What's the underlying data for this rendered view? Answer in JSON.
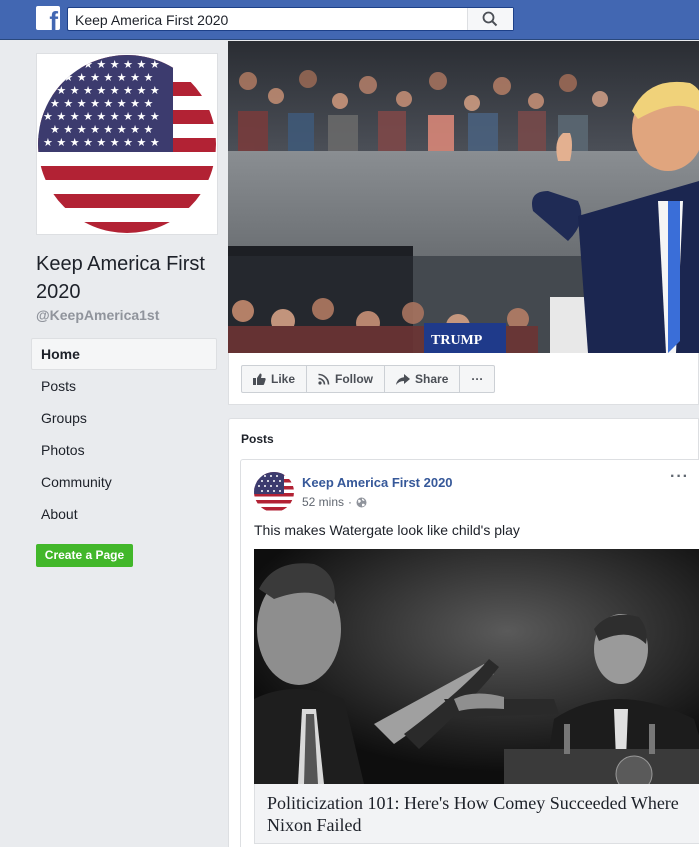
{
  "search": {
    "value": "Keep America First 2020"
  },
  "page": {
    "name": "Keep America First 2020",
    "handle": "@KeepAmerica1st"
  },
  "nav": {
    "items": [
      "Home",
      "Posts",
      "Groups",
      "Photos",
      "Community",
      "About"
    ],
    "active": "Home"
  },
  "create_page_label": "Create a Page",
  "actions": {
    "like": "Like",
    "follow": "Follow",
    "share": "Share",
    "more": "···"
  },
  "posts": {
    "section_title": "Posts",
    "post": {
      "author": "Keep America First 2020",
      "time": "52 mins",
      "separator": "·",
      "text": "This makes Watergate look like child's play",
      "link_title": "Politicization 101: Here's How Comey Succeeded Where Nixon Failed",
      "more": "···"
    }
  },
  "icons": [
    "facebook-logo-icon",
    "search-icon",
    "like-icon",
    "follow-rss-icon",
    "share-icon",
    "globe-icon"
  ],
  "colors": {
    "brand": "#4267b2",
    "link": "#365899",
    "create_button": "#42b72a",
    "page_bg": "#e9ebee"
  }
}
